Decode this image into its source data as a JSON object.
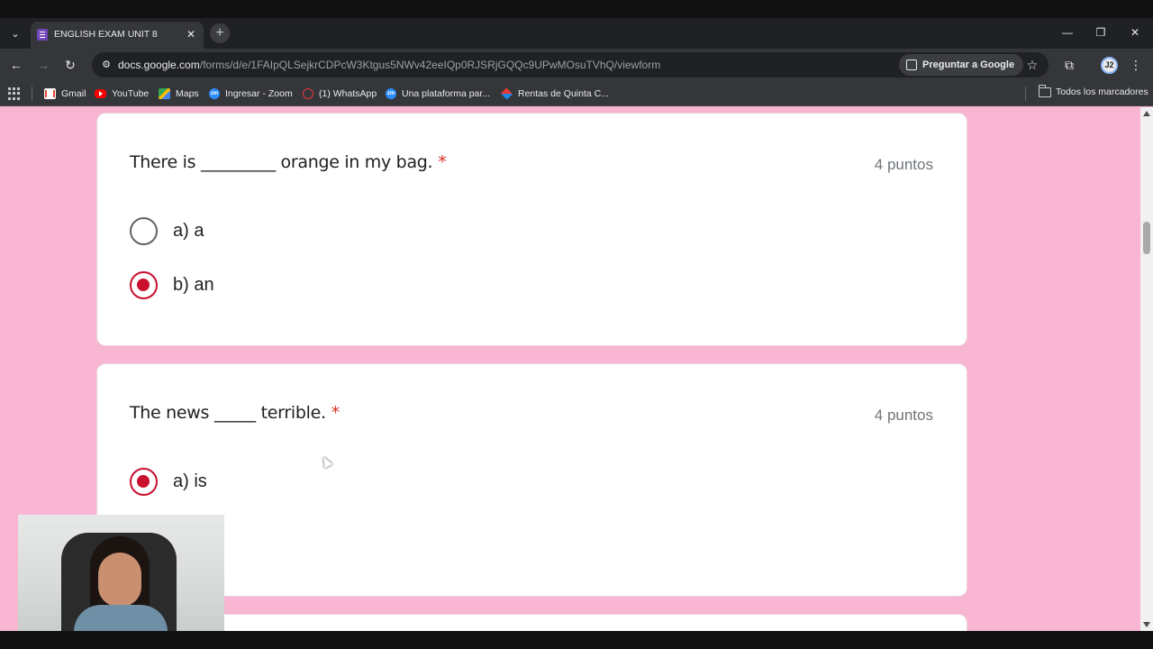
{
  "browser": {
    "tab": {
      "title": "ENGLISH EXAM UNIT 8",
      "close": "✕"
    },
    "new_tab": "+",
    "window_controls": {
      "minimize": "—",
      "restore": "❐",
      "close": "✕"
    },
    "nav": {
      "back": "←",
      "forward": "→",
      "reload": "↻"
    },
    "url": {
      "host": "docs.google.com",
      "path": "/forms/d/e/1FAIpQLSejkrCDPcW3Ktgus5NWv42eeIQp0RJSRjGQQc9UPwMOsuTVhQ/viewform"
    },
    "ask_google": "Preguntar a Google",
    "profile_initials": "J2",
    "bookmarks": [
      {
        "label": "Gmail",
        "icon": "gmail-icon"
      },
      {
        "label": "YouTube",
        "icon": "youtube-icon"
      },
      {
        "label": "Maps",
        "icon": "maps-icon"
      },
      {
        "label": "Ingresar - Zoom",
        "icon": "zoom-icon"
      },
      {
        "label": "(1) WhatsApp",
        "icon": "whatsapp-icon"
      },
      {
        "label": "Una plataforma par...",
        "icon": "zoom-icon"
      },
      {
        "label": "Rentas de Quinta C...",
        "icon": "rentas-icon"
      }
    ],
    "all_bookmarks": "Todos los marcadores"
  },
  "form": {
    "questions": [
      {
        "text": "There is _________ orange in my bag.",
        "required_mark": "*",
        "points": "4 puntos",
        "options": [
          {
            "label": "a) a",
            "selected": false
          },
          {
            "label": "b) an",
            "selected": true
          }
        ]
      },
      {
        "text": "The news _____ terrible.",
        "required_mark": "*",
        "points": "4 puntos",
        "options": [
          {
            "label": "a) is",
            "selected": true
          }
        ]
      }
    ]
  },
  "colors": {
    "page_background": "#f8b6d3",
    "radio_selected": "#c9102f",
    "required": "#d93025",
    "chrome_dark": "#202124"
  }
}
